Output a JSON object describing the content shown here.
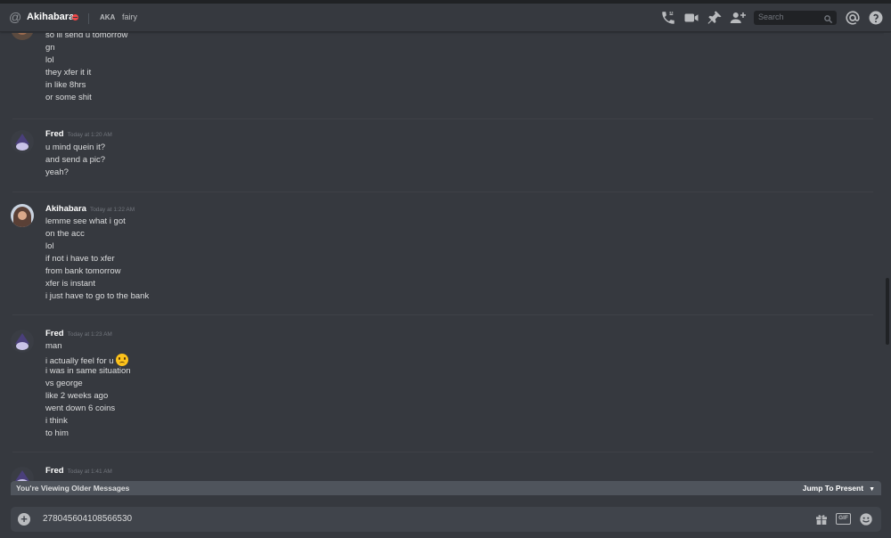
{
  "header": {
    "username": "Akihabara",
    "aka_label": "AKA",
    "nickname": "fairy",
    "search_placeholder": "Search",
    "icons": [
      "at-icon",
      "phone-call-icon",
      "video-call-icon",
      "pin-icon",
      "add-friend-icon",
      "search-icon",
      "mention-icon",
      "help-icon"
    ],
    "status_color": "#f04747"
  },
  "messages": {
    "continuation": {
      "lines": [
        "so ill send u tomorrow",
        "gn",
        "lol",
        "they xfer it it",
        "in like 8hrs",
        "or some shit"
      ]
    },
    "groups": [
      {
        "author": "Fred",
        "timestamp": "Today at 1:20 AM",
        "lines": [
          "u mind quein it?",
          "and send a pic?",
          "yeah?"
        ]
      },
      {
        "author": "Akihabara",
        "timestamp": "Today at 1:22 AM",
        "lines": [
          "lemme see what i got",
          "on the acc",
          "lol",
          "if not i have to xfer",
          "from bank tomorrow",
          "xfer is instant",
          "i just have to go to the bank"
        ]
      },
      {
        "author": "Fred",
        "timestamp": "Today at 1:23 AM",
        "lines": [
          "man",
          "i actually feel for u",
          "i was in same situation",
          "vs george",
          "like 2 weeks ago",
          "went down 6 coins",
          "i think",
          "to him"
        ]
      },
      {
        "author": "Fred",
        "timestamp": "Today at 1:41 AM",
        "lines": []
      }
    ]
  },
  "older_banner": {
    "label": "You're Viewing Older Messages",
    "jump_label": "Jump To Present"
  },
  "composer": {
    "value": "278045604108566530",
    "icons": [
      "add-attachment-icon",
      "gift-icon",
      "gif-icon",
      "emoji-icon"
    ],
    "gif_label": "GIF"
  },
  "colors": {
    "background": "#36393f",
    "header_text": "#ffffff",
    "timestamp": "#72767d",
    "banner": "#4f545c"
  }
}
